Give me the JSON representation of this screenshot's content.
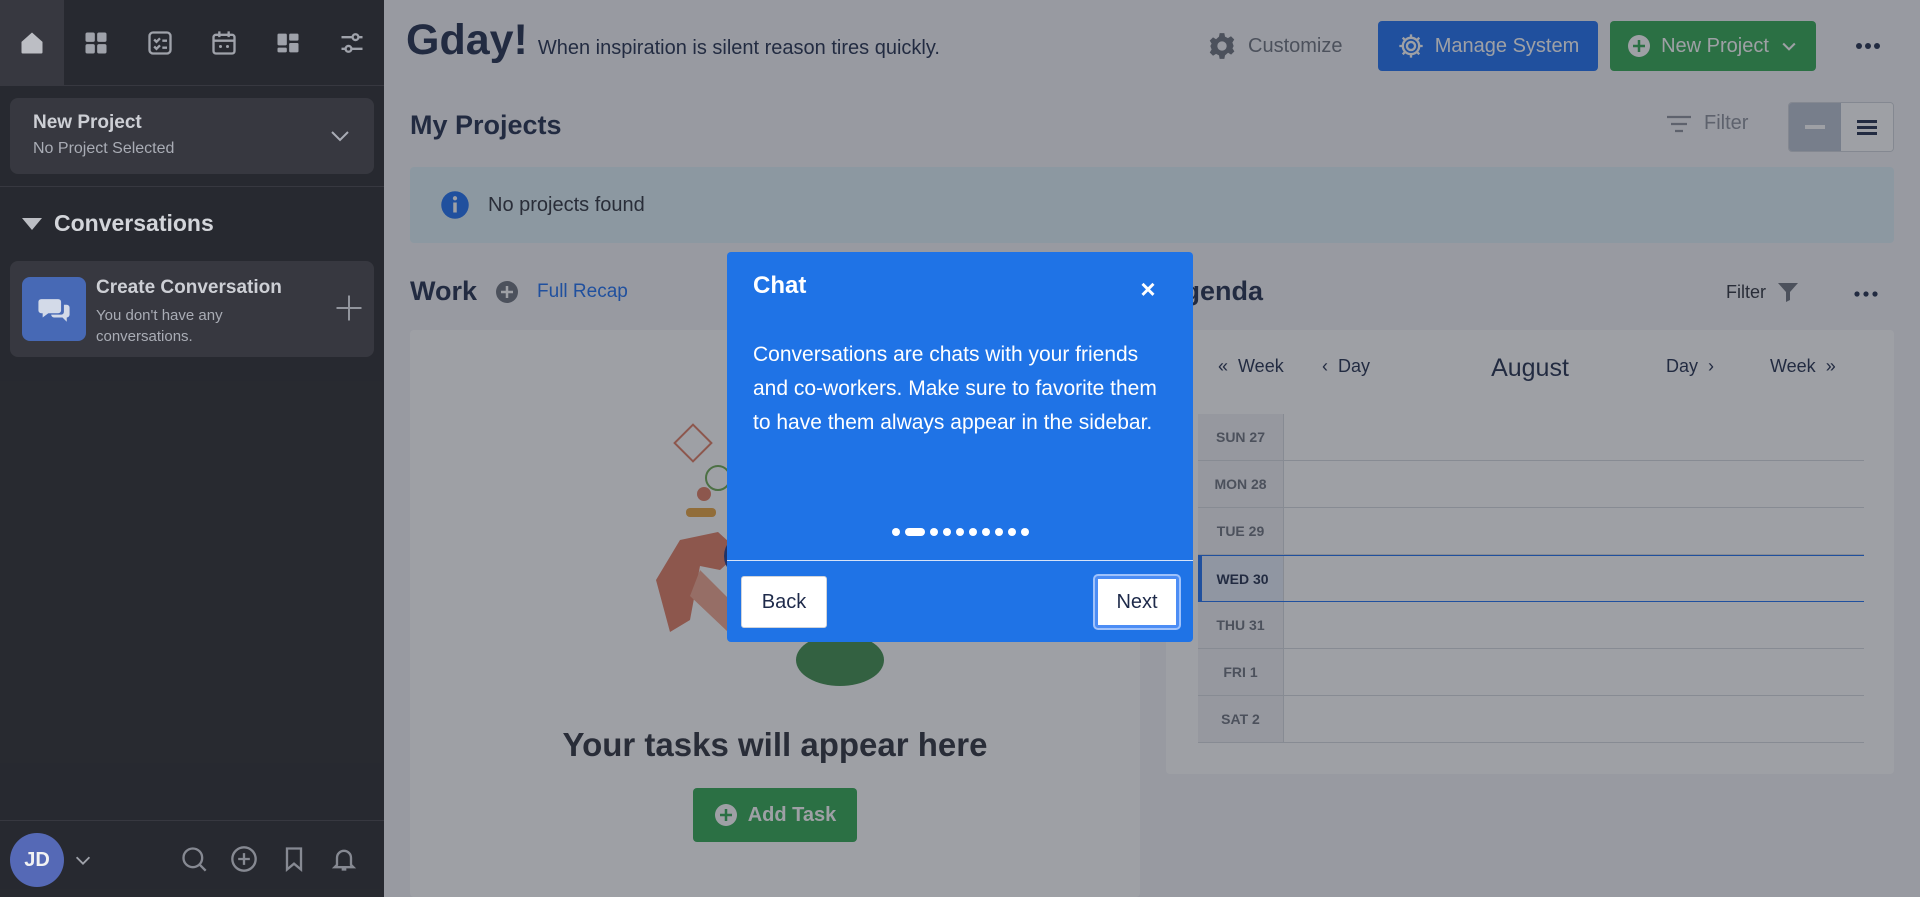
{
  "sidebar": {
    "nav_icons": [
      "home-icon",
      "grid-icon",
      "checklist-icon",
      "calendar-icon",
      "dashboard-icon",
      "sliders-icon"
    ],
    "project_select": {
      "title": "New Project",
      "subtitle": "No Project Selected"
    },
    "conversations": {
      "heading": "Conversations",
      "create_title": "Create Conversation",
      "create_subtitle": "You don't have any conversations."
    },
    "user": {
      "initials": "JD"
    }
  },
  "header": {
    "greeting": "Gday!",
    "tagline": "When inspiration is silent reason tires quickly.",
    "customize_label": "Customize",
    "manage_label": "Manage System",
    "new_project_label": "New Project"
  },
  "projects": {
    "title": "My Projects",
    "filter_label": "Filter",
    "empty_message": "No projects found"
  },
  "work": {
    "title": "Work",
    "recap_label": "Full Recap",
    "empty_title": "Your tasks will appear here",
    "add_task_label": "Add Task"
  },
  "agenda": {
    "title": "Agenda",
    "filter_label": "Filter",
    "prev_week_label": "Week",
    "prev_day_label": "Day",
    "month": "August",
    "next_day_label": "Day",
    "next_week_label": "Week",
    "days": [
      "SUN 27",
      "MON 28",
      "TUE 29",
      "WED 30",
      "THU 31",
      "FRI 1",
      "SAT 2"
    ],
    "today_index": 3
  },
  "tour": {
    "title": "Chat",
    "close_label": "×",
    "body": "Conversations are chats with your friends and co-workers. Make sure to favorite them to have them always appear in the sidebar.",
    "step_count": 10,
    "current_step": 2,
    "back_label": "Back",
    "next_label": "Next"
  },
  "colors": {
    "primary": "#1b6ef3",
    "success": "#2fa84f",
    "sidebar_bg": "#2a2c33",
    "popup_bg": "#1f73e6"
  }
}
